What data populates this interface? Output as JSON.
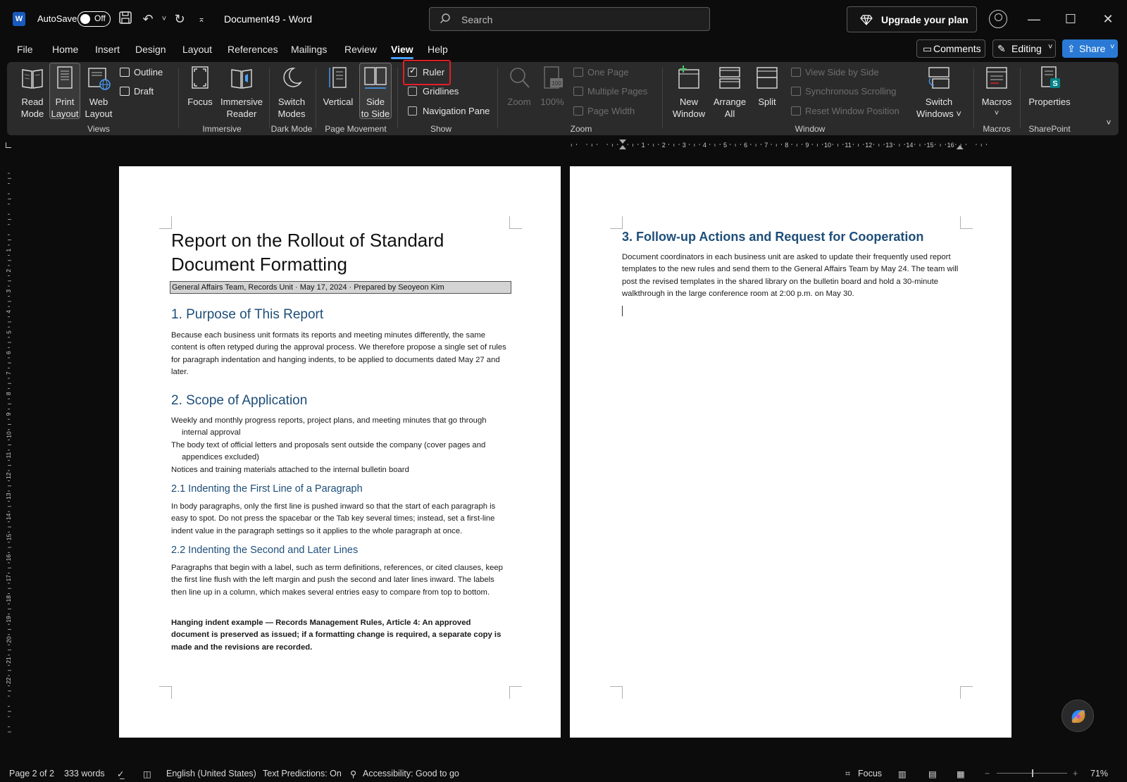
{
  "titlebar": {
    "autosave_label": "AutoSave",
    "autosave_state": "Off",
    "document_title": "Document49  -  Word",
    "search_placeholder": "Search",
    "upgrade_label": "Upgrade your plan"
  },
  "menu": {
    "tabs": [
      "File",
      "Home",
      "Insert",
      "Design",
      "Layout",
      "References",
      "Mailings",
      "Review",
      "View",
      "Help"
    ],
    "active_tab": "View",
    "comments_label": "Comments",
    "editing_label": "Editing",
    "share_label": "Share"
  },
  "ribbon": {
    "views": {
      "read_mode": [
        "Read",
        "Mode"
      ],
      "print_layout": [
        "Print",
        "Layout"
      ],
      "web_layout": [
        "Web",
        "Layout"
      ],
      "outline": "Outline",
      "draft": "Draft",
      "group": "Views"
    },
    "immersive": {
      "focus": "Focus",
      "immersive_reader": [
        "Immersive",
        "Reader"
      ],
      "group": "Immersive"
    },
    "dark_mode": {
      "switch_modes": [
        "Switch",
        "Modes"
      ],
      "group": "Dark Mode"
    },
    "page_movement": {
      "vertical": "Vertical",
      "side_to_side": [
        "Side",
        "to Side"
      ],
      "group": "Page Movement"
    },
    "show": {
      "ruler": "Ruler",
      "gridlines": "Gridlines",
      "navigation_pane": "Navigation Pane",
      "group": "Show",
      "ruler_checked": true,
      "gridlines_checked": false,
      "navigation_pane_checked": false
    },
    "zoom": {
      "zoom": "Zoom",
      "hundred": "100%",
      "one_page": "One Page",
      "multiple_pages": "Multiple Pages",
      "page_width": "Page Width",
      "group": "Zoom"
    },
    "window": {
      "new_window": [
        "New",
        "Window"
      ],
      "arrange_all": [
        "Arrange",
        "All"
      ],
      "split": "Split",
      "view_side_by_side": "View Side by Side",
      "synchronous_scrolling": "Synchronous Scrolling",
      "reset_window_position": "Reset Window Position",
      "switch_windows": [
        "Switch",
        "Windows ˅"
      ],
      "group": "Window"
    },
    "macros": {
      "label": "Macros",
      "group": "Macros"
    },
    "sharepoint": {
      "properties": "Properties",
      "group": "SharePoint"
    }
  },
  "ruler": {
    "h_ticks": [
      "1",
      "2",
      "3",
      "4",
      "5",
      "6",
      "7",
      "8",
      "9",
      "10",
      "11",
      "12",
      "13",
      "14",
      "15",
      "16"
    ],
    "v_ticks": [
      "1",
      "2",
      "3",
      "4",
      "5",
      "6",
      "7",
      "8",
      "9",
      "10",
      "11",
      "12",
      "13",
      "14",
      "15",
      "16",
      "17",
      "18",
      "19",
      "20",
      "21",
      "22"
    ]
  },
  "page1": {
    "title": "Report on the Rollout of Standard Document Formatting",
    "subtitle": "General Affairs Team, Records Unit · May 17, 2024 · Prepared by Seoyeon Kim",
    "h_purpose": "1. Purpose of This Report",
    "p_purpose": "Because each business unit formats its reports and meeting minutes differently, the same content is often retyped during the approval process. We therefore propose a single set of rules for paragraph indentation and hanging indents, to be applied to documents dated May 27 and later.",
    "h_scope": "2. Scope of Application",
    "scope_items": [
      "Weekly and monthly progress reports, project plans, and meeting minutes that go through internal approval",
      "The body text of official letters and proposals sent outside the company (cover pages and appendices excluded)",
      "Notices and training materials attached to the internal bulletin board"
    ],
    "h_first_line": "2.1 Indenting the First Line of a Paragraph",
    "p_first_line": "In body paragraphs, only the first line is pushed inward so that the start of each paragraph is easy to spot. Do not press the spacebar or the Tab key several times; instead, set a first-line indent value in the paragraph settings so it applies to the whole paragraph at once.",
    "h_second_line": "2.2 Indenting the Second and Later Lines",
    "p_second_line": "Paragraphs that begin with a label, such as term definitions, references, or cited clauses, keep the first line flush with the left margin and push the second and later lines inward. The labels then line up in a column, which makes several entries easy to compare from top to bottom.",
    "p_example": "Hanging indent example — Records Management Rules, Article 4: An approved document is preserved as issued; if a formatting change is required, a separate copy is made and the revisions are recorded."
  },
  "page2": {
    "h_followup": "3. Follow-up Actions and Request for Cooperation",
    "p_followup": "Document coordinators in each business unit are asked to update their frequently used report templates to the new rules and send them to the General Affairs Team by May 24. The team will post the revised templates in the shared library on the bulletin board and hold a 30-minute walkthrough in the large conference room at 2:00 p.m. on May 30."
  },
  "status": {
    "page": "Page 2 of 2",
    "words": "333 words",
    "language": "English (United States)",
    "predictions": "Text Predictions: On",
    "accessibility": "Accessibility: Good to go",
    "focus": "Focus",
    "zoom": "71%"
  },
  "colors": {
    "accent": "#4aa0ff",
    "heading": "#1e4e79",
    "highlight": "#e0202a",
    "share": "#2a7ad5"
  }
}
